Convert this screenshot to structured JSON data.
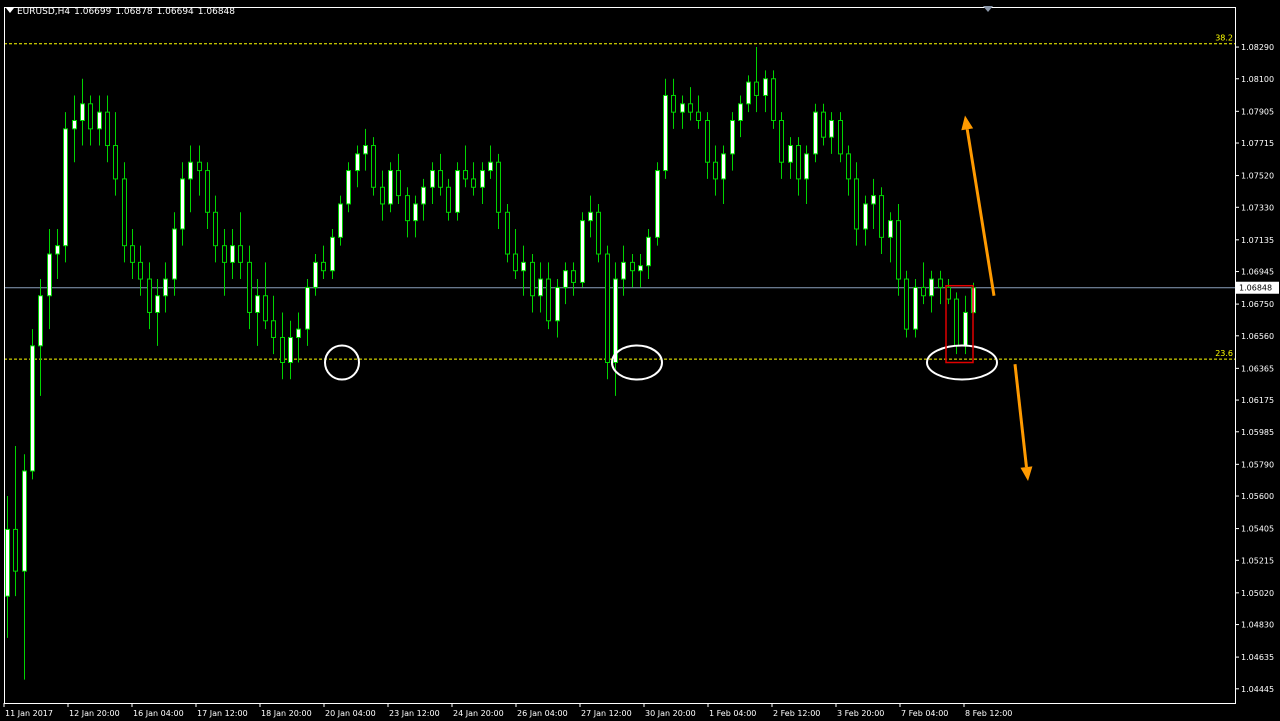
{
  "header": {
    "symbol": "EURUSD,H4",
    "open": "1.06699",
    "high": "1.06878",
    "low": "1.06694",
    "close": "1.06848"
  },
  "colors": {
    "background": "#000000",
    "frame": "#ffffff",
    "bull_candle": "#ffffff",
    "bear_candle": "#000000",
    "wick": "#00d400",
    "fib_line": "#ffff00",
    "price_line": "#8aa0bc",
    "price_label_bg": "#ffffff",
    "highlight_box": "#e00000",
    "ellipse": "#ffffff",
    "arrow": "#ff9a00"
  },
  "chart_data": {
    "type": "candlestick",
    "symbol": "EURUSD",
    "timeframe": "H4",
    "ylim": [
      1.0436,
      1.0853
    ],
    "y_ticks": [
      "1.08290",
      "1.08100",
      "1.07905",
      "1.07715",
      "1.07520",
      "1.07330",
      "1.07135",
      "1.06945",
      "1.06750",
      "1.06560",
      "1.06365",
      "1.06175",
      "1.05985",
      "1.05790",
      "1.05600",
      "1.05405",
      "1.05215",
      "1.05020",
      "1.04830",
      "1.04635",
      "1.04445"
    ],
    "x_ticks": [
      "11 Jan 2017",
      "12 Jan 20:00",
      "16 Jan 04:00",
      "17 Jan 12:00",
      "18 Jan 20:00",
      "20 Jan 04:00",
      "23 Jan 12:00",
      "24 Jan 20:00",
      "26 Jan 04:00",
      "27 Jan 12:00",
      "30 Jan 20:00",
      "1 Feb 04:00",
      "2 Feb 12:00",
      "3 Feb 20:00",
      "7 Feb 04:00",
      "8 Feb 12:00"
    ],
    "current_price": 1.06848,
    "current_price_label": "1.06848",
    "fib_levels": [
      {
        "label": "38.2",
        "price": 1.0831
      },
      {
        "label": "23.6",
        "price": 1.0642
      }
    ],
    "candles": [
      [
        1.05,
        1.056,
        1.0475,
        1.054
      ],
      [
        1.054,
        1.059,
        1.05,
        1.0515
      ],
      [
        1.0515,
        1.0585,
        1.045,
        1.0575
      ],
      [
        1.0575,
        1.066,
        1.057,
        1.065
      ],
      [
        1.065,
        1.069,
        1.062,
        1.068
      ],
      [
        1.068,
        1.072,
        1.066,
        1.0705
      ],
      [
        1.0705,
        1.072,
        1.069,
        1.071
      ],
      [
        1.071,
        1.079,
        1.07,
        1.078
      ],
      [
        1.078,
        1.08,
        1.076,
        1.0785
      ],
      [
        1.0785,
        1.081,
        1.077,
        1.0795
      ],
      [
        1.0795,
        1.08,
        1.077,
        1.078
      ],
      [
        1.078,
        1.08,
        1.077,
        1.079
      ],
      [
        1.079,
        1.08,
        1.076,
        1.077
      ],
      [
        1.077,
        1.079,
        1.074,
        1.075
      ],
      [
        1.075,
        1.076,
        1.07,
        1.071
      ],
      [
        1.071,
        1.072,
        1.069,
        1.07
      ],
      [
        1.07,
        1.071,
        1.068,
        1.069
      ],
      [
        1.069,
        1.07,
        1.066,
        1.067
      ],
      [
        1.067,
        1.069,
        1.065,
        1.068
      ],
      [
        1.068,
        1.07,
        1.067,
        1.069
      ],
      [
        1.069,
        1.073,
        1.068,
        1.072
      ],
      [
        1.072,
        1.076,
        1.071,
        1.075
      ],
      [
        1.075,
        1.077,
        1.073,
        1.076
      ],
      [
        1.076,
        1.077,
        1.074,
        1.0755
      ],
      [
        1.0755,
        1.076,
        1.072,
        1.073
      ],
      [
        1.073,
        1.074,
        1.07,
        1.071
      ],
      [
        1.071,
        1.072,
        1.068,
        1.07
      ],
      [
        1.07,
        1.072,
        1.069,
        1.071
      ],
      [
        1.071,
        1.073,
        1.069,
        1.07
      ],
      [
        1.07,
        1.071,
        1.066,
        1.067
      ],
      [
        1.067,
        1.069,
        1.065,
        1.068
      ],
      [
        1.068,
        1.07,
        1.066,
        1.0665
      ],
      [
        1.0665,
        1.068,
        1.0645,
        1.0655
      ],
      [
        1.0655,
        1.067,
        1.063,
        1.064
      ],
      [
        1.064,
        1.0665,
        1.063,
        1.0655
      ],
      [
        1.0655,
        1.067,
        1.064,
        1.066
      ],
      [
        1.066,
        1.069,
        1.065,
        1.0685
      ],
      [
        1.0685,
        1.0705,
        1.068,
        1.07
      ],
      [
        1.07,
        1.071,
        1.069,
        1.0695
      ],
      [
        1.0695,
        1.072,
        1.069,
        1.0715
      ],
      [
        1.0715,
        1.074,
        1.071,
        1.0735
      ],
      [
        1.0735,
        1.076,
        1.073,
        1.0755
      ],
      [
        1.0755,
        1.077,
        1.0745,
        1.0765
      ],
      [
        1.0765,
        1.078,
        1.0755,
        1.077
      ],
      [
        1.077,
        1.0775,
        1.074,
        1.0745
      ],
      [
        1.0745,
        1.0755,
        1.0725,
        1.0735
      ],
      [
        1.0735,
        1.076,
        1.073,
        1.0755
      ],
      [
        1.0755,
        1.0765,
        1.0735,
        1.074
      ],
      [
        1.074,
        1.0745,
        1.0715,
        1.0725
      ],
      [
        1.0725,
        1.074,
        1.0715,
        1.0735
      ],
      [
        1.0735,
        1.075,
        1.0725,
        1.0745
      ],
      [
        1.0745,
        1.076,
        1.0735,
        1.0755
      ],
      [
        1.0755,
        1.0765,
        1.074,
        1.0745
      ],
      [
        1.0745,
        1.075,
        1.0725,
        1.073
      ],
      [
        1.073,
        1.076,
        1.0725,
        1.0755
      ],
      [
        1.0755,
        1.077,
        1.0745,
        1.075
      ],
      [
        1.075,
        1.076,
        1.074,
        1.0745
      ],
      [
        1.0745,
        1.076,
        1.0735,
        1.0755
      ],
      [
        1.0755,
        1.077,
        1.075,
        1.076
      ],
      [
        1.076,
        1.0765,
        1.072,
        1.073
      ],
      [
        1.073,
        1.0735,
        1.07,
        1.0705
      ],
      [
        1.0705,
        1.072,
        1.069,
        1.0695
      ],
      [
        1.0695,
        1.071,
        1.068,
        1.07
      ],
      [
        1.07,
        1.0705,
        1.067,
        1.068
      ],
      [
        1.068,
        1.07,
        1.067,
        1.069
      ],
      [
        1.069,
        1.07,
        1.066,
        1.0665
      ],
      [
        1.0665,
        1.069,
        1.0655,
        1.0685
      ],
      [
        1.0685,
        1.07,
        1.0675,
        1.0695
      ],
      [
        1.0695,
        1.07,
        1.068,
        1.0688
      ],
      [
        1.0688,
        1.073,
        1.0685,
        1.0725
      ],
      [
        1.0725,
        1.074,
        1.0715,
        1.073
      ],
      [
        1.073,
        1.0735,
        1.07,
        1.0705
      ],
      [
        1.0705,
        1.071,
        1.063,
        1.064
      ],
      [
        1.064,
        1.07,
        1.062,
        1.069
      ],
      [
        1.069,
        1.071,
        1.068,
        1.07
      ],
      [
        1.07,
        1.0705,
        1.0685,
        1.0695
      ],
      [
        1.0695,
        1.0705,
        1.0685,
        1.0698
      ],
      [
        1.0698,
        1.072,
        1.069,
        1.0715
      ],
      [
        1.0715,
        1.076,
        1.071,
        1.0755
      ],
      [
        1.0755,
        1.081,
        1.075,
        1.08
      ],
      [
        1.08,
        1.081,
        1.078,
        1.079
      ],
      [
        1.079,
        1.08,
        1.078,
        1.0795
      ],
      [
        1.0795,
        1.0805,
        1.0785,
        1.079
      ],
      [
        1.079,
        1.08,
        1.078,
        1.0785
      ],
      [
        1.0785,
        1.079,
        1.075,
        1.076
      ],
      [
        1.076,
        1.077,
        1.074,
        1.075
      ],
      [
        1.075,
        1.077,
        1.0735,
        1.0765
      ],
      [
        1.0765,
        1.079,
        1.0755,
        1.0785
      ],
      [
        1.0785,
        1.08,
        1.0775,
        1.0795
      ],
      [
        1.0795,
        1.0812,
        1.079,
        1.0808
      ],
      [
        1.0808,
        1.0829,
        1.079,
        1.08
      ],
      [
        1.08,
        1.0815,
        1.079,
        1.081
      ],
      [
        1.081,
        1.0815,
        1.078,
        1.0785
      ],
      [
        1.0785,
        1.079,
        1.075,
        1.076
      ],
      [
        1.076,
        1.0775,
        1.075,
        1.077
      ],
      [
        1.077,
        1.0775,
        1.074,
        1.075
      ],
      [
        1.075,
        1.077,
        1.0735,
        1.0765
      ],
      [
        1.0765,
        1.0795,
        1.076,
        1.079
      ],
      [
        1.079,
        1.0795,
        1.077,
        1.0775
      ],
      [
        1.0775,
        1.079,
        1.0765,
        1.0785
      ],
      [
        1.0785,
        1.079,
        1.076,
        1.0765
      ],
      [
        1.0765,
        1.077,
        1.074,
        1.075
      ],
      [
        1.075,
        1.076,
        1.071,
        1.072
      ],
      [
        1.072,
        1.074,
        1.071,
        1.0735
      ],
      [
        1.0735,
        1.075,
        1.072,
        1.074
      ],
      [
        1.074,
        1.0745,
        1.0705,
        1.0715
      ],
      [
        1.0715,
        1.073,
        1.07,
        1.0725
      ],
      [
        1.0725,
        1.0735,
        1.068,
        1.069
      ],
      [
        1.069,
        1.0695,
        1.0655,
        1.066
      ],
      [
        1.066,
        1.069,
        1.0655,
        1.0685
      ],
      [
        1.0685,
        1.07,
        1.0675,
        1.068
      ],
      [
        1.068,
        1.0695,
        1.067,
        1.069
      ],
      [
        1.069,
        1.0695,
        1.0675,
        1.0685
      ],
      [
        1.0685,
        1.069,
        1.0675,
        1.0678
      ],
      [
        1.0678,
        1.0682,
        1.0645,
        1.065
      ],
      [
        1.065,
        1.068,
        1.0645,
        1.067
      ],
      [
        1.06699,
        1.06878,
        1.06694,
        1.06848
      ]
    ]
  }
}
